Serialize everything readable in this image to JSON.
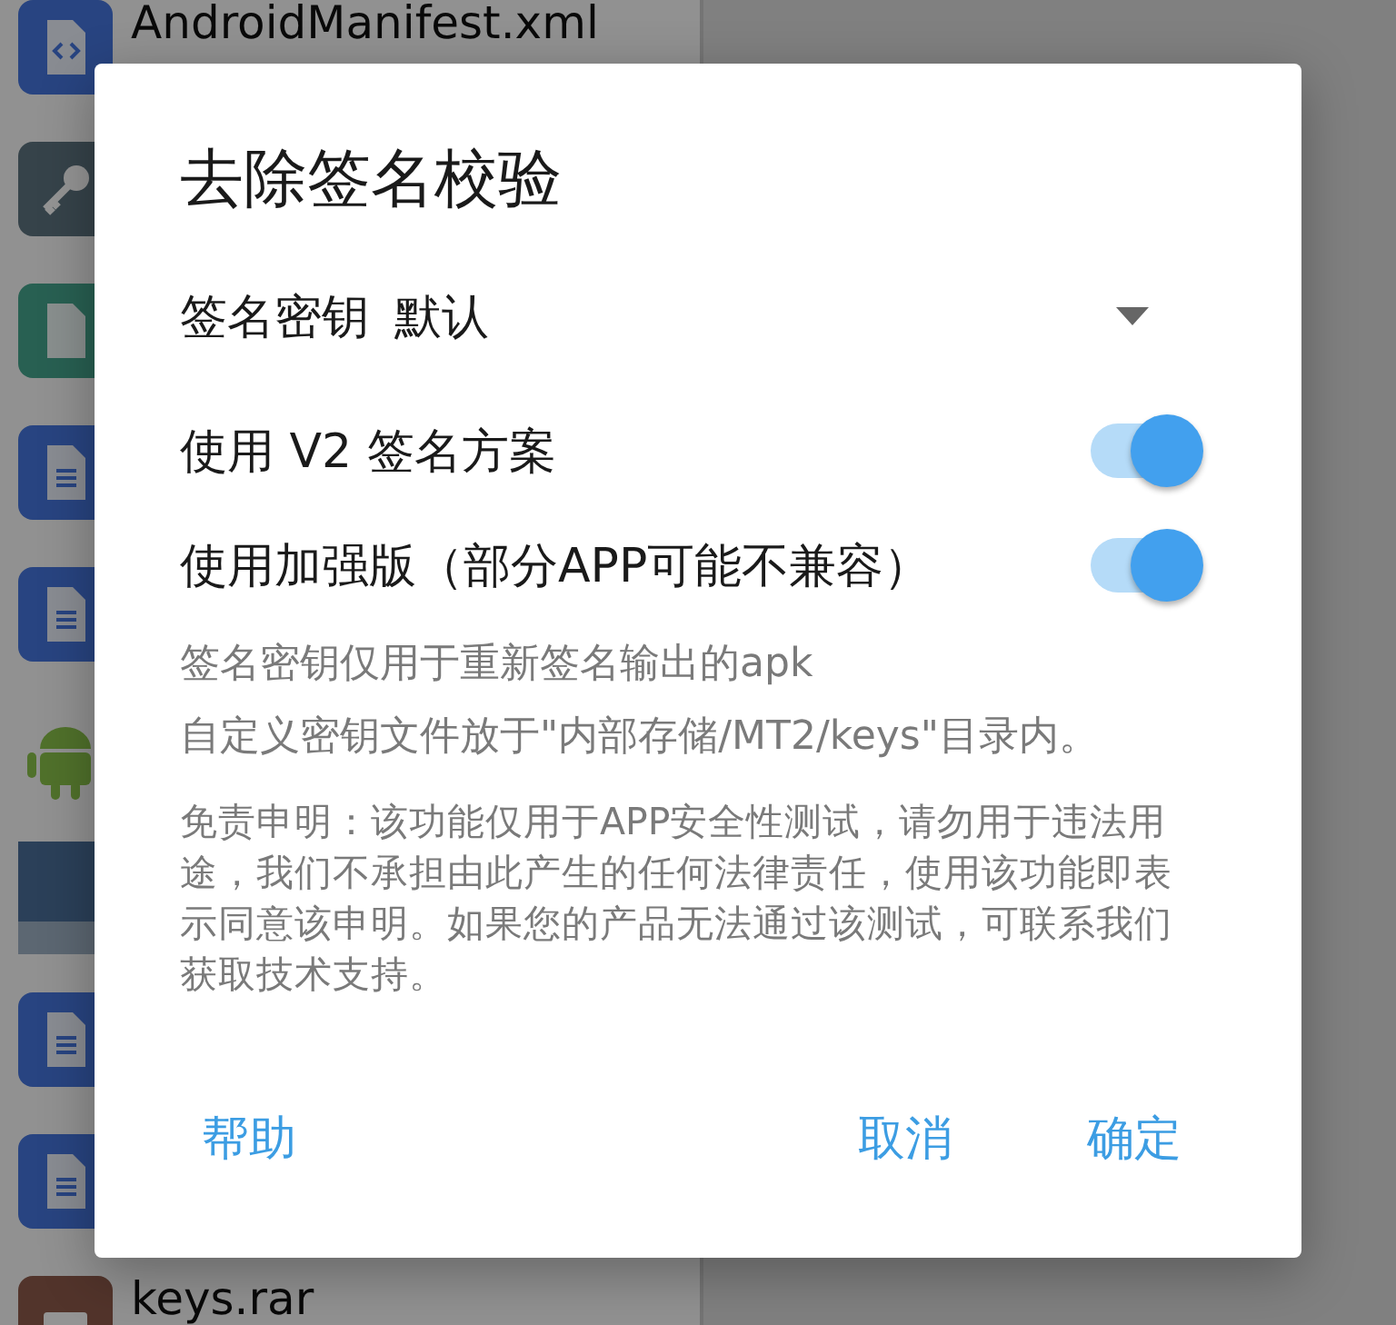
{
  "file_list": [
    {
      "kind": "xml",
      "name": "AndroidManifest.xml"
    },
    {
      "kind": "key"
    },
    {
      "kind": "binary"
    },
    {
      "kind": "document"
    },
    {
      "kind": "document"
    },
    {
      "kind": "android"
    },
    {
      "kind": "photo"
    },
    {
      "kind": "document"
    },
    {
      "kind": "document"
    },
    {
      "kind": "archive",
      "name": "keys.rar"
    }
  ],
  "dialog": {
    "title": "去除签名校验",
    "key_select": {
      "label": "签名密钥",
      "value": "默认"
    },
    "switches": [
      {
        "label": "使用 V2 签名方案",
        "on": true
      },
      {
        "label": "使用加强版（部分APP可能不兼容）",
        "on": true
      }
    ],
    "notes": [
      "签名密钥仅用于重新签名输出的apk",
      "自定义密钥文件放于\"内部存储/MT2/keys\"目录内。"
    ],
    "disclaimer": "免责申明：该功能仅用于APP安全性测试，请勿用于违法用途，我们不承担由此产生的任何法律责任，使用该功能即表示同意该申明。如果您的产品无法通过该测试，可联系我们获取技术支持。",
    "buttons_left": [
      "帮助"
    ],
    "buttons_right": [
      "取消",
      "确定"
    ]
  }
}
